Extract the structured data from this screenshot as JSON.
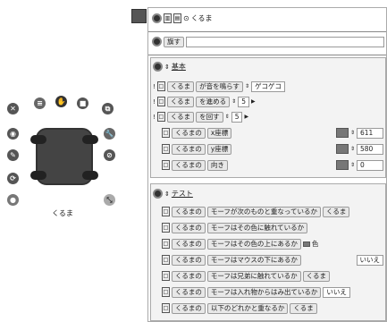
{
  "header": {
    "title": "くるま"
  },
  "empty_script": {
    "label": "旗す"
  },
  "basic": {
    "title": "基本",
    "rows": [
      {
        "subject": "くるま",
        "verb": "が音を鳴らす",
        "arg": "ゲコゲコ"
      },
      {
        "subject": "くるま",
        "verb": "を進める",
        "arg": "5"
      },
      {
        "subject": "くるま",
        "verb": "を回す",
        "arg": "5"
      },
      {
        "subject": "くるまの",
        "verb": "x座標",
        "value": "611"
      },
      {
        "subject": "くるまの",
        "verb": "y座標",
        "value": "580"
      },
      {
        "subject": "くるまの",
        "verb": "向き",
        "value": "0"
      }
    ]
  },
  "test": {
    "title": "テスト",
    "rows": [
      {
        "subject": "くるまの",
        "verb": "モーフが次のものと重なっているか",
        "arg": "くるま"
      },
      {
        "subject": "くるまの",
        "verb": "モーフはその色に触れているか",
        "arg": ""
      },
      {
        "subject": "くるまの",
        "verb": "モーフはその色の上にあるか",
        "arg": "色"
      },
      {
        "subject": "くるまの",
        "verb": "モーフはマウスの下にあるか",
        "arg": "いいえ"
      },
      {
        "subject": "くるまの",
        "verb": "モーフは兄弟に触れているか",
        "arg": "くるま"
      },
      {
        "subject": "くるまの",
        "verb": "モーフは入れ物からはみ出ているか",
        "arg": "いいえ"
      },
      {
        "subject": "くるまの",
        "verb": "以下のどれかと重なるか",
        "arg": "くるま"
      }
    ]
  },
  "viewer": {
    "label": "くるま"
  },
  "colors": {
    "panel_bg": "#f3f3f3",
    "tile_bg": "#e8e8e8",
    "car": "#444444"
  }
}
